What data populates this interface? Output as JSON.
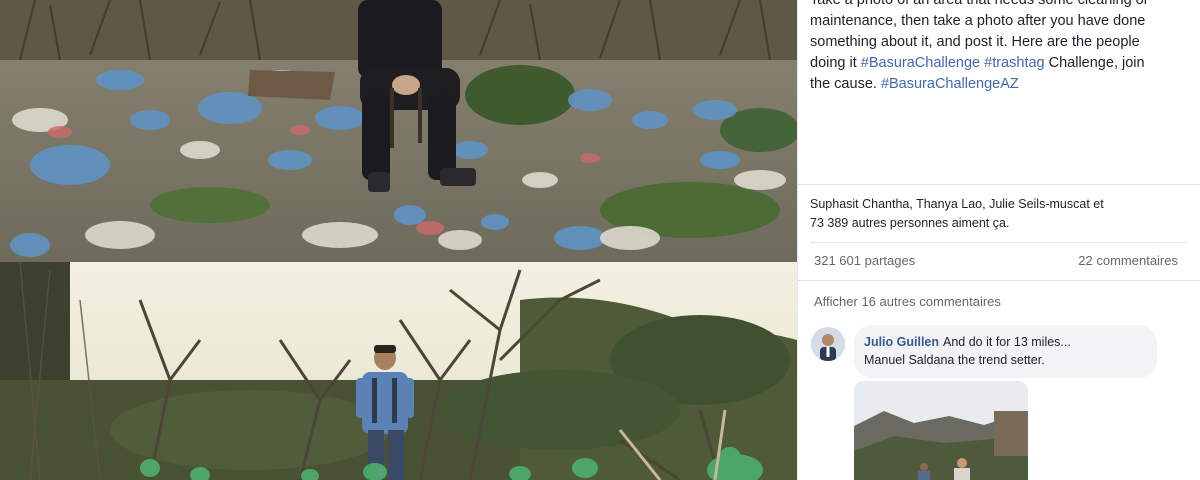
{
  "post": {
    "caption_lines": [
      "Take a photo of an area that needs some cleaning or",
      "maintenance, then take a photo after you have done",
      "something about it, and post it. Here are the people"
    ],
    "caption_line4_prefix": "doing it ",
    "hashtag_1": "#BasuraChallenge",
    "hashtag_2": "#trashtag",
    "caption_line4_suffix": " Challenge, join",
    "caption_line5_prefix": "the cause. ",
    "hashtag_3": "#BasuraChallengeAZ"
  },
  "reactions": {
    "line1": "Suphasit Chantha, Thanya Lao, Julie Seils-muscat et",
    "line2": "73 389 autres personnes aiment ça."
  },
  "stats": {
    "shares": "321 601 partages",
    "comments": "22 commentaires"
  },
  "comments_section": {
    "more_link": "Afficher 16 autres commentaires",
    "comment": {
      "author": "Julio Guillen",
      "text_line1": "And do it for 13 miles...",
      "text_line2": "Manuel Saldana the trend setter."
    }
  }
}
